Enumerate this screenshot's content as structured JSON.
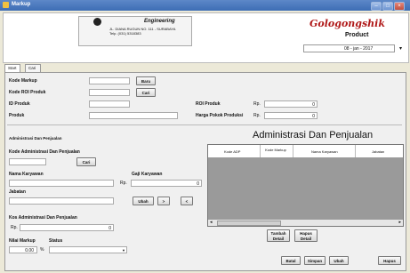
{
  "window": {
    "title": "Markup"
  },
  "banner": {
    "company": "Engineering",
    "address": "JL. DIANA RUGUN NO. 111 - SURABAYA",
    "phone": "Telp. (031) 5318383",
    "brand": "Gologongshik",
    "product_label": "Product",
    "date_value": "08 - jan - 2017"
  },
  "tabs": [
    "Start Up",
    "Cari Data"
  ],
  "form": {
    "kode_markup_label": "Kode Markup",
    "baru_btn": "Baru",
    "kode_roi_label": "Kode ROI Produk",
    "cari_btn": "Cari",
    "id_produk_label": "ID Produk",
    "roi_produk_label": "ROI Produk",
    "rp1": "Rp.",
    "roi_value": "0",
    "produk_label": "Produk",
    "harga_label": "Harga Pokok Produksi",
    "rp2": "Rp.",
    "harga_value": "0"
  },
  "admin": {
    "section_title": "Administrasi Dan Penjualan",
    "big_title": "Administrasi Dan Penjualan",
    "kode_admin_label": "Kode Administrasi Dan Penjualan",
    "cari_btn": "Cari",
    "nama_label": "Nama Karyawan",
    "gaji_label": "Gaji Karyawan",
    "rp": "Rp.",
    "gaji_value": "0",
    "jabatan_label": "Jabatan",
    "ubah_btn": "Ubah",
    "next_btn": ">",
    "prev_btn": "<",
    "kos_label": "Kos Administrasi Dan Penjualan",
    "kos_rp": "Rp.",
    "kos_value": "0",
    "nilai_label": "Nilai Markup",
    "nilai_value": "0.00",
    "percent": "%",
    "status_label": "Status"
  },
  "grid": {
    "headers": [
      "Kode ADP",
      "Kode Markup",
      "Nama Karyawan",
      "Jabatan"
    ]
  },
  "actions": {
    "tambah": "Tambah Detail",
    "hapus_detail": "Hapus Detail",
    "batal": "Batal",
    "simpan": "Simpan",
    "ubah": "Ubah",
    "hapus": "Hapus"
  }
}
